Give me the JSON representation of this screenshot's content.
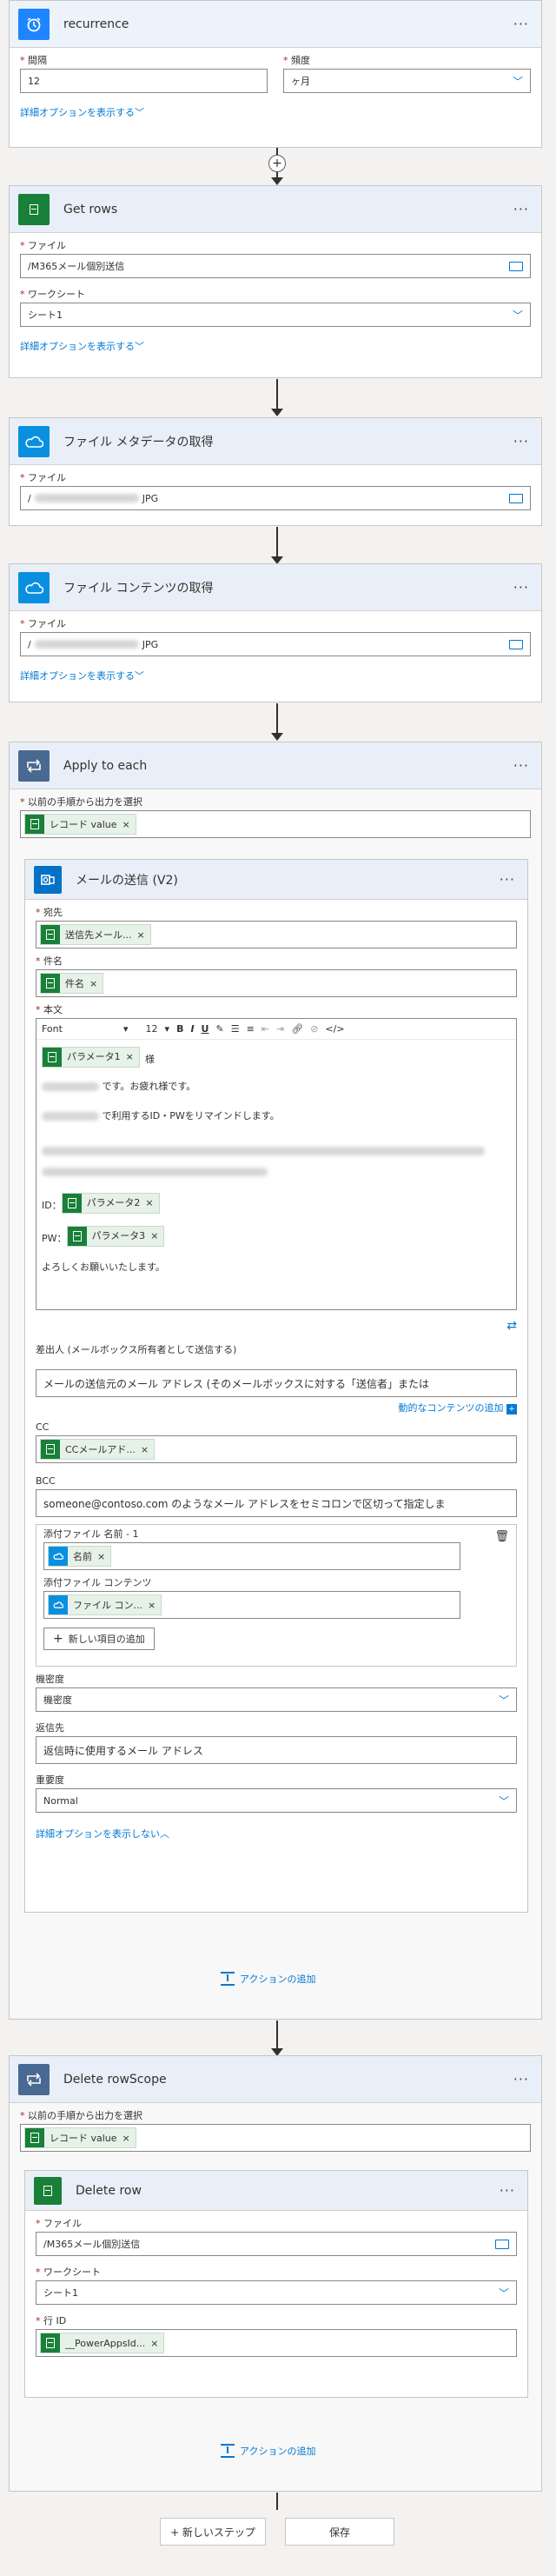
{
  "recurrence": {
    "title": "recurrence",
    "interval_label": "間隔",
    "interval_value": "12",
    "frequency_label": "頻度",
    "frequency_value": "ヶ月",
    "advanced_link": "詳細オプションを表示する"
  },
  "get_rows": {
    "title": "Get rows",
    "file_label": "ファイル",
    "file_value": "/M365メール個別送信",
    "sheet_label": "ワークシート",
    "sheet_value": "シート1",
    "advanced_link": "詳細オプションを表示する"
  },
  "file_metadata": {
    "title": "ファイル メタデータの取得",
    "file_label": "ファイル",
    "file_prefix": "/",
    "file_suffix": "JPG"
  },
  "file_content": {
    "title": "ファイル コンテンツの取得",
    "file_label": "ファイル",
    "file_prefix": "/",
    "file_suffix": "JPG",
    "advanced_link": "詳細オプションを表示する"
  },
  "apply_each": {
    "title": "Apply to each",
    "select_label": "以前の手順から出力を選択",
    "token": "レコード value"
  },
  "send_mail": {
    "title": "メールの送信 (V2)",
    "to_label": "宛先",
    "to_token": "送信先メール...",
    "subject_label": "件名",
    "subject_token": "件名",
    "body_label": "本文",
    "font_name": "Font",
    "font_size": "12",
    "param1": "パラメータ1",
    "sama": "様",
    "greeting_line": "です。お疲れ様です。",
    "remind_line": "で利用するID・PWをリマインドします。",
    "id_label": "ID：",
    "param2": "パラメータ2",
    "pw_label": "PW：",
    "param3": "パラメータ3",
    "closing": "よろしくお願いいたします。",
    "from_label": "差出人 (メールボックス所有者として送信する)",
    "from_placeholder": "メールの送信元のメール アドレス (そのメールボックスに対する「送信者」または",
    "dynamic_link": "動的なコンテンツの追加",
    "cc_label": "CC",
    "cc_token": "CCメールアド...",
    "bcc_label": "BCC",
    "bcc_placeholder": "someone@contoso.com のようなメール アドレスをセミコロンで区切って指定しま",
    "attach_name_label": "添付ファイル 名前 - 1",
    "attach_name_token": "名前",
    "attach_content_label": "添付ファイル コンテンツ",
    "attach_content_token": "ファイル コン...",
    "add_item": "新しい項目の追加",
    "sensitivity_label": "機密度",
    "sensitivity_value": "機密度",
    "reply_label": "返信先",
    "reply_placeholder": "返信時に使用するメール アドレス",
    "importance_label": "重要度",
    "importance_value": "Normal",
    "hide_link": "詳細オプションを表示しない"
  },
  "add_action_1": "アクションの追加",
  "delete_scope": {
    "title": "Delete rowScope",
    "select_label": "以前の手順から出力を選択",
    "token": "レコード value"
  },
  "delete_row": {
    "title": "Delete row",
    "file_label": "ファイル",
    "file_value": "/M365メール個別送信",
    "sheet_label": "ワークシート",
    "sheet_value": "シート1",
    "row_label": "行 ID",
    "row_token": "__PowerAppsId..."
  },
  "add_action_2": "アクションの追加",
  "new_step": "+ 新しいステップ",
  "save": "保存"
}
